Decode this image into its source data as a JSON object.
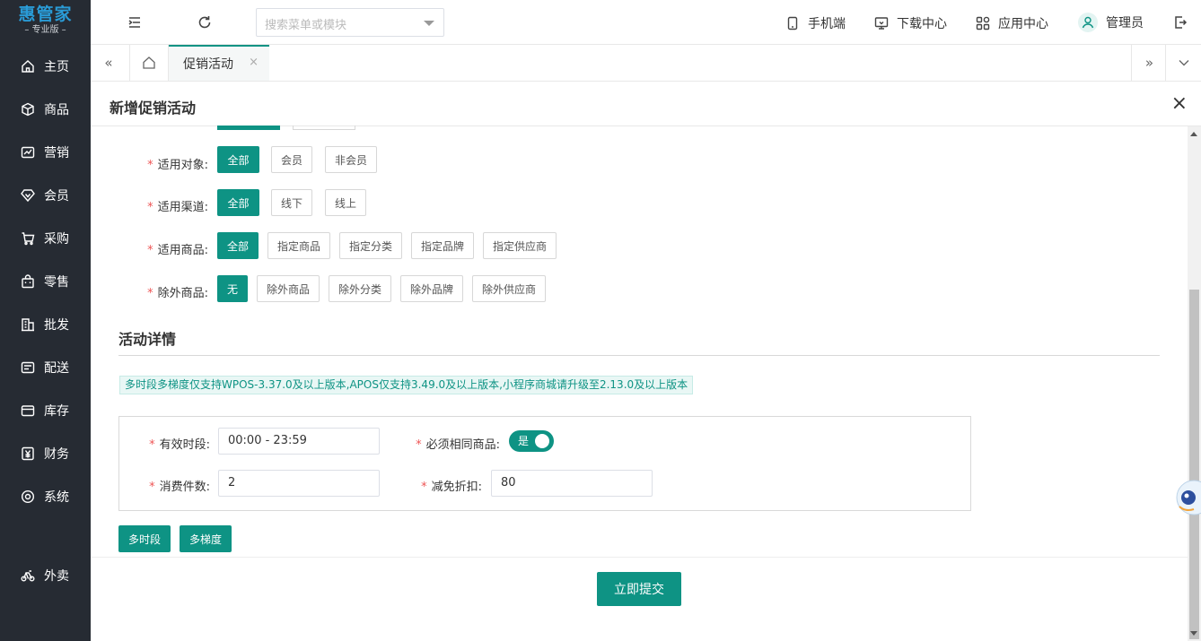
{
  "brand": {
    "name": "惠管家",
    "edition": "– 专业版 –"
  },
  "sidebar": {
    "items": [
      {
        "label": "主页",
        "icon": "home-icon"
      },
      {
        "label": "商品",
        "icon": "cube-icon"
      },
      {
        "label": "营销",
        "icon": "chart-icon"
      },
      {
        "label": "会员",
        "icon": "diamond-icon"
      },
      {
        "label": "采购",
        "icon": "cart-icon"
      },
      {
        "label": "零售",
        "icon": "bag-icon"
      },
      {
        "label": "批发",
        "icon": "building-icon"
      },
      {
        "label": "配送",
        "icon": "truck-icon"
      },
      {
        "label": "库存",
        "icon": "box-icon"
      },
      {
        "label": "财务",
        "icon": "yen-icon"
      },
      {
        "label": "系统",
        "icon": "settings-icon"
      },
      {
        "label": "外卖",
        "icon": "bike-icon"
      }
    ]
  },
  "topbar": {
    "search_placeholder": "搜索菜单或模块",
    "mobile": "手机端",
    "download": "下载中心",
    "apps": "应用中心",
    "user": "管理员"
  },
  "tabs": {
    "active": "促销活动"
  },
  "panel": {
    "title": "新增促销活动"
  },
  "form": {
    "target": {
      "label": "适用对象:",
      "options": [
        "全部",
        "会员",
        "非会员"
      ],
      "selected": 0
    },
    "channel": {
      "label": "适用渠道:",
      "options": [
        "全部",
        "线下",
        "线上"
      ],
      "selected": 0
    },
    "goods": {
      "label": "适用商品:",
      "options": [
        "全部",
        "指定商品",
        "指定分类",
        "指定品牌",
        "指定供应商"
      ],
      "selected": 0
    },
    "exclude": {
      "label": "除外商品:",
      "options": [
        "无",
        "除外商品",
        "除外分类",
        "除外品牌",
        "除外供应商"
      ],
      "selected": 0
    }
  },
  "details": {
    "section_title": "活动详情",
    "notice": "多时段多梯度仅支持WPOS-3.37.0及以上版本,APOS仅支持3.49.0及以上版本,小程序商城请升级至2.13.0及以上版本",
    "period_label": "有效时段:",
    "period_value": "00:00 - 23:59",
    "same_goods_label": "必须相同商品:",
    "same_goods_switch": "是",
    "qty_label": "消费件数:",
    "qty_value": "2",
    "discount_label": "减免折扣:",
    "discount_value": "80",
    "multi_period": "多时段",
    "multi_tier": "多梯度"
  },
  "footer": {
    "submit": "立即提交"
  },
  "colors": {
    "accent": "#0e9384",
    "sidebar": "#262b33",
    "brand": "#2a9bd6",
    "required": "#e55555"
  }
}
